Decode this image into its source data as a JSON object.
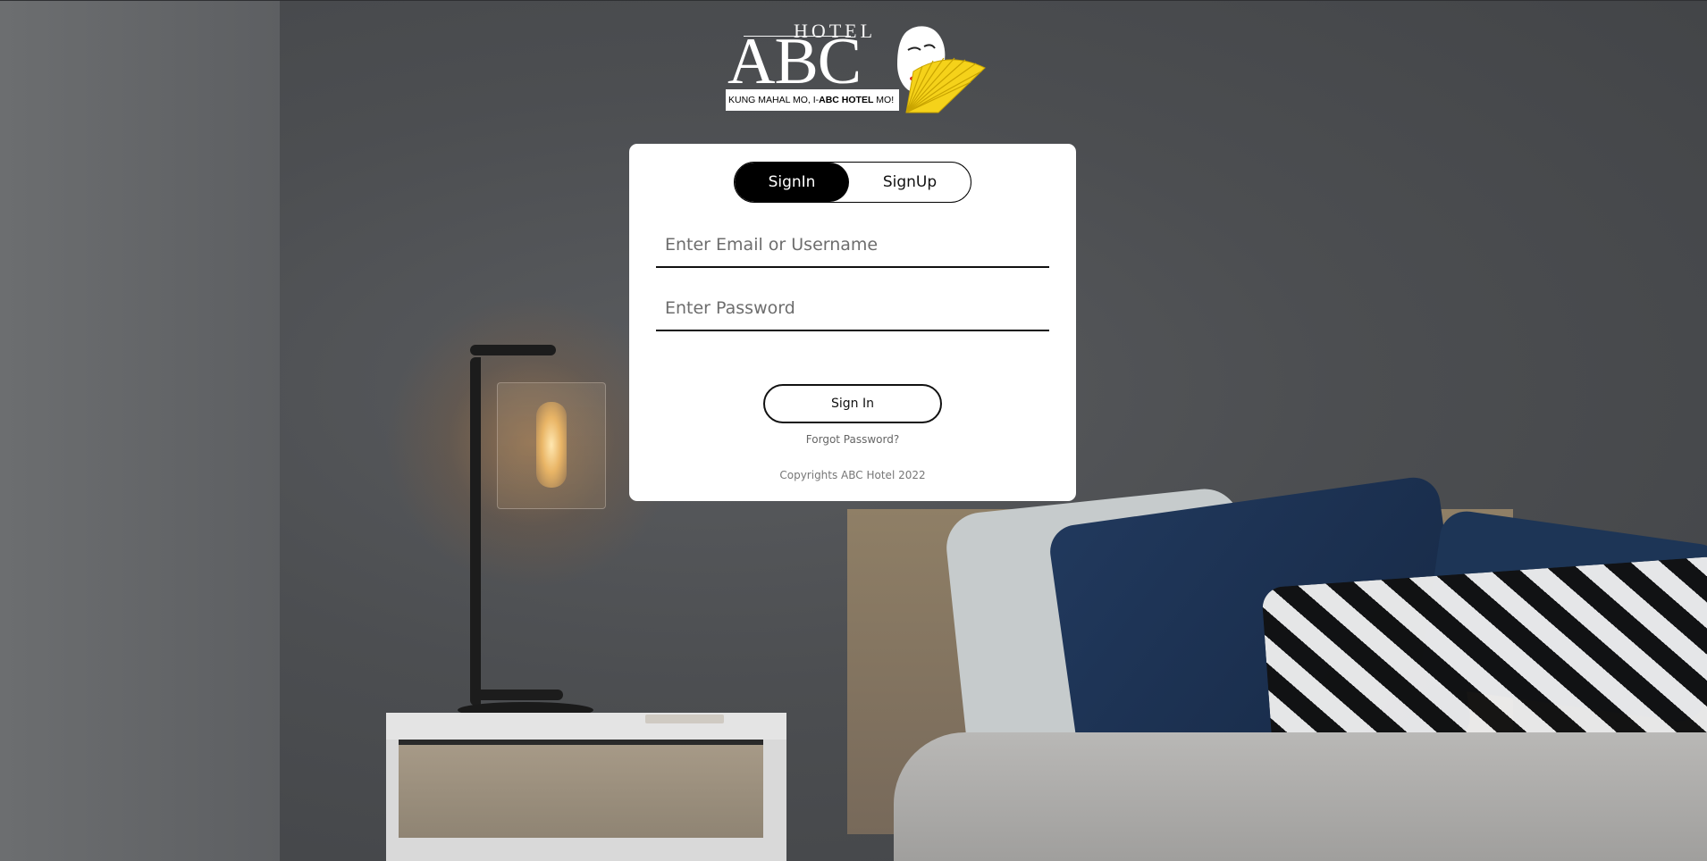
{
  "logo": {
    "hotel_word": "HOTEL",
    "brand": "ABC",
    "tagline_prefix": "KUNG MAHAL MO, I-",
    "tagline_bold": "ABC HOTEL",
    "tagline_suffix": " MO!"
  },
  "auth": {
    "tabs": {
      "signin_label": "SignIn",
      "signup_label": "SignUp",
      "active": "SignIn"
    },
    "email_placeholder": "Enter Email or Username",
    "email_value": "",
    "password_placeholder": "Enter Password",
    "password_value": "",
    "submit_label": "Sign In",
    "forgot_label": "Forgot Password?",
    "copyright": "Copyrights ABC Hotel 2022"
  },
  "colors": {
    "card_background": "#ffffff",
    "active_tab": "#000000",
    "overlay": "#4a4c4f",
    "fan_yellow": "#f5d21a"
  },
  "icons": {
    "logo_mask": "white-geisha-mask-icon",
    "logo_fan": "yellow-folding-fan-icon"
  }
}
